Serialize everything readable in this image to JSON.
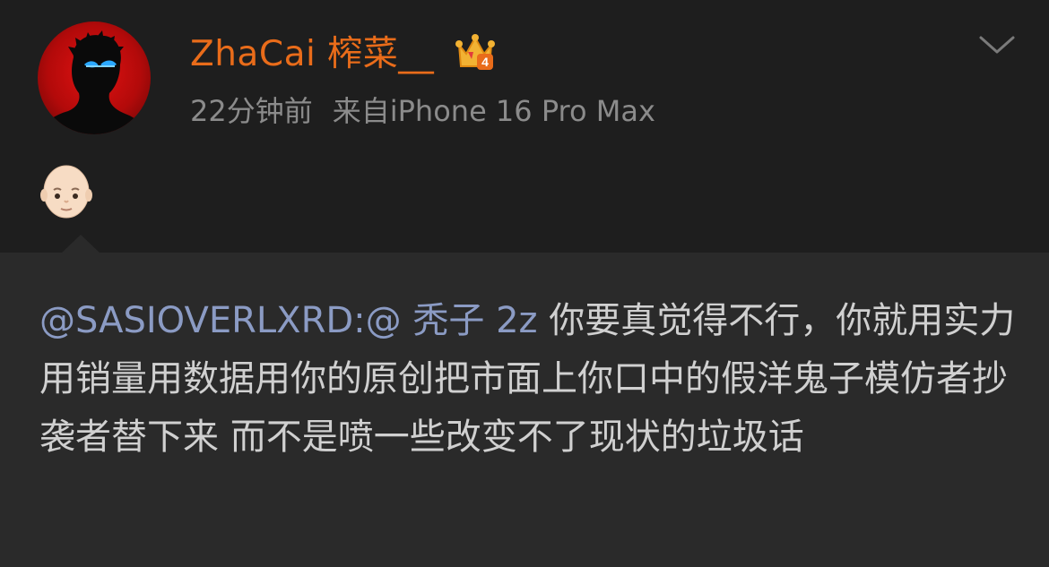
{
  "post": {
    "author": {
      "name": "ZhaCai 榨菜__",
      "vip_badge": "crown-vip-icon",
      "vip_level": "4",
      "colors": {
        "name": "#e96c1a",
        "badge": "#f2b233"
      }
    },
    "meta": {
      "time": "22分钟前",
      "source": "来自iPhone 16 Pro Max"
    },
    "content_emoji": "bald-person-emoji",
    "more_icon": "chevron-down-icon"
  },
  "repost": {
    "mention": "@SASIOVERLXRD:@ 秃子 2z",
    "text": " 你要真觉得不行，你就用实力用销量用数据用你的原创把市面上你口中的假洋鬼子模仿者抄袭者替下来  而不是喷一些改变不了现状的垃圾话"
  },
  "theme": {
    "background": "#1e1e1e",
    "repost_background": "#2a2a2a",
    "text": "#d0d0d0",
    "meta_text": "#8b8b8b",
    "mention": "#8b9bc4"
  }
}
